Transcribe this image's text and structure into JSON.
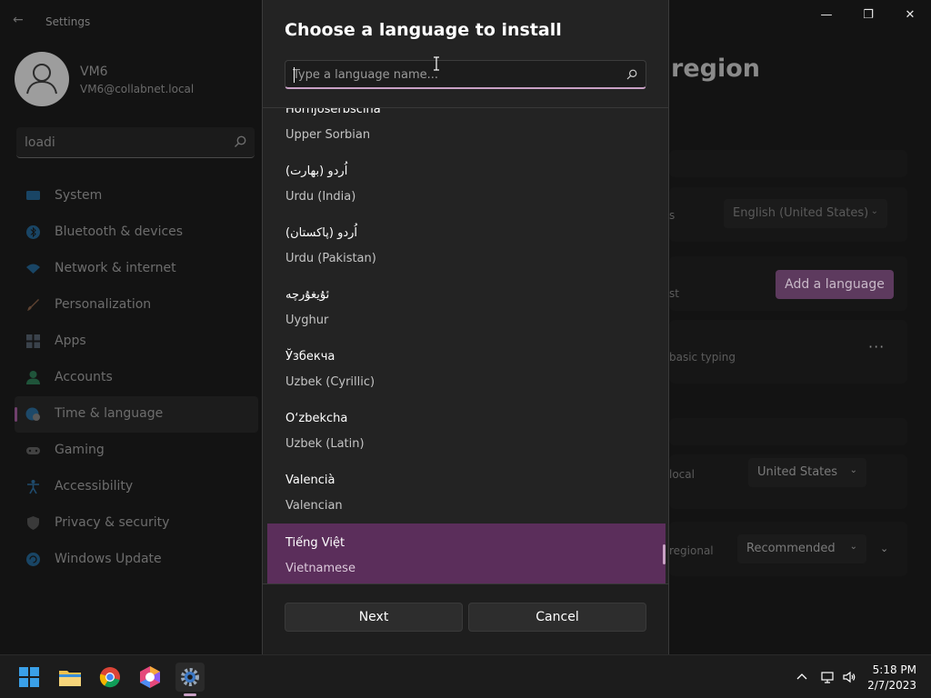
{
  "window": {
    "app_title": "Settings",
    "controls": {
      "minimize": "—",
      "maximize": "❐",
      "close": "✕"
    }
  },
  "profile": {
    "name": "VM6",
    "email": "VM6@collabnet.local"
  },
  "sidebar": {
    "search_value": "loadi",
    "items": [
      {
        "label": "System",
        "icon": "system-icon",
        "color": "#1f6fa8"
      },
      {
        "label": "Bluetooth & devices",
        "icon": "bluetooth-icon",
        "color": "#1f6fa8"
      },
      {
        "label": "Network & internet",
        "icon": "network-icon",
        "color": "#1f6fa8"
      },
      {
        "label": "Personalization",
        "icon": "brush-icon",
        "color": "#9a6a4a"
      },
      {
        "label": "Apps",
        "icon": "apps-icon",
        "color": "#5a6a7a"
      },
      {
        "label": "Accounts",
        "icon": "accounts-icon",
        "color": "#2a8a5a"
      },
      {
        "label": "Time & language",
        "icon": "globe-clock-icon",
        "color": "#1f6fa8"
      },
      {
        "label": "Gaming",
        "icon": "gamepad-icon",
        "color": "#6a6a6a"
      },
      {
        "label": "Accessibility",
        "icon": "accessibility-icon",
        "color": "#2a7ab8"
      },
      {
        "label": "Privacy & security",
        "icon": "shield-icon",
        "color": "#5a5a5a"
      },
      {
        "label": "Windows Update",
        "icon": "update-icon",
        "color": "#1f6fa8"
      }
    ],
    "active_index": 6
  },
  "background_page": {
    "title": "region",
    "row1_label": "s",
    "row1_value": "English (United States)",
    "row2_label": "st",
    "add_language": "Add a language",
    "row3_label": "basic typing",
    "ellipsis": "···",
    "row4_label": "local",
    "row4_value": "United States",
    "row5_label": "regional",
    "row5_value": "Recommended"
  },
  "dialog": {
    "title": "Choose a language to install",
    "search_placeholder": "Type a language name...",
    "languages": [
      {
        "native": "Hornjoserbšćina",
        "english": "Upper Sorbian",
        "selected": false
      },
      {
        "native": "اُردو (بھارت)",
        "english": "Urdu (India)",
        "selected": false
      },
      {
        "native": "اُردو (پاکستان)",
        "english": "Urdu (Pakistan)",
        "selected": false
      },
      {
        "native": "ئۇيغۇرچە",
        "english": "Uyghur",
        "selected": false
      },
      {
        "native": "Ўзбекча",
        "english": "Uzbek (Cyrillic)",
        "selected": false
      },
      {
        "native": "O‘zbekcha",
        "english": "Uzbek (Latin)",
        "selected": false
      },
      {
        "native": "Valencià",
        "english": "Valencian",
        "selected": false
      },
      {
        "native": "Tiếng Việt",
        "english": "Vietnamese",
        "selected": true
      }
    ],
    "next_label": "Next",
    "cancel_label": "Cancel"
  },
  "taskbar": {
    "apps": [
      "start-icon",
      "file-explorer-icon",
      "chrome-icon",
      "copilot-icon",
      "settings-icon"
    ],
    "time": "5:18 PM",
    "date": "2/7/2023"
  },
  "colors": {
    "accent": "#c9a1c5",
    "selected_row": "#5b2e5b",
    "dialog_bg": "#232323"
  }
}
